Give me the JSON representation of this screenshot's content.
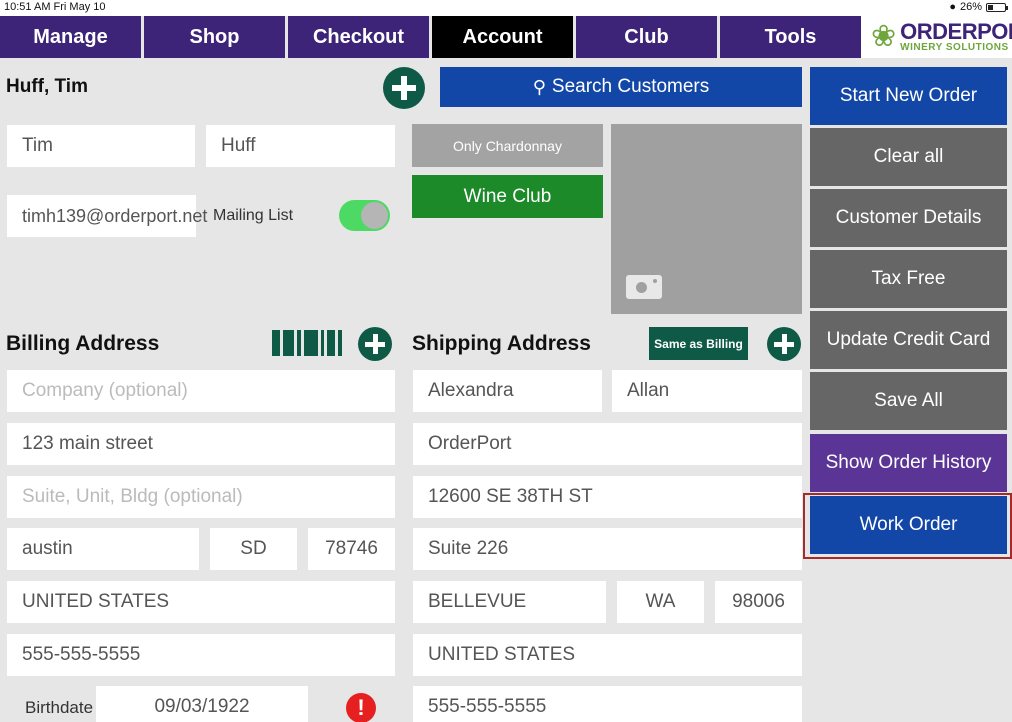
{
  "status": {
    "time": "10:51 AM  Fri May 10",
    "battery": "26%"
  },
  "nav": {
    "tabs": [
      "Manage",
      "Shop",
      "Checkout",
      "Account",
      "Club",
      "Tools"
    ],
    "active": "Account"
  },
  "logo": {
    "brand": "ORDERPORT",
    "sub": "WINERY SOLUTIONS"
  },
  "customer": {
    "name": "Huff, Tim",
    "first": "Tim",
    "last": "Huff",
    "email": "timh139@orderport.net",
    "mailing_label": "Mailing List"
  },
  "search": {
    "label": "Search Customers"
  },
  "club": {
    "only_label": "Only Chardonnay",
    "club_label": "Wine Club"
  },
  "billing": {
    "heading": "Billing Address",
    "company_ph": "Company (optional)",
    "street": "123 main street",
    "suite_ph": "Suite, Unit, Bldg (optional)",
    "city": "austin",
    "state": "SD",
    "zip": "78746",
    "country": "UNITED STATES",
    "phone": "555-555-5555",
    "birthdate_label": "Birthdate",
    "birthdate": "09/03/1922"
  },
  "shipping": {
    "heading": "Shipping Address",
    "same_label": "Same as Billing",
    "first": "Alexandra",
    "last": "Allan",
    "company": "OrderPort",
    "street": "12600 SE 38TH ST",
    "suite": "Suite 226",
    "city": "BELLEVUE",
    "state": "WA",
    "zip": "98006",
    "country": "UNITED STATES",
    "phone": "555-555-5555"
  },
  "sidebar": {
    "start": "Start New Order",
    "clear": "Clear all",
    "details": "Customer Details",
    "tax": "Tax Free",
    "credit": "Update Credit Card",
    "save": "Save All",
    "history": "Show Order History",
    "work": "Work Order"
  },
  "colors": {
    "nav": "#3e2479",
    "blue": "#1247a8",
    "green": "#0e5a47",
    "club": "#1c8a28",
    "sidegray": "#666666"
  }
}
